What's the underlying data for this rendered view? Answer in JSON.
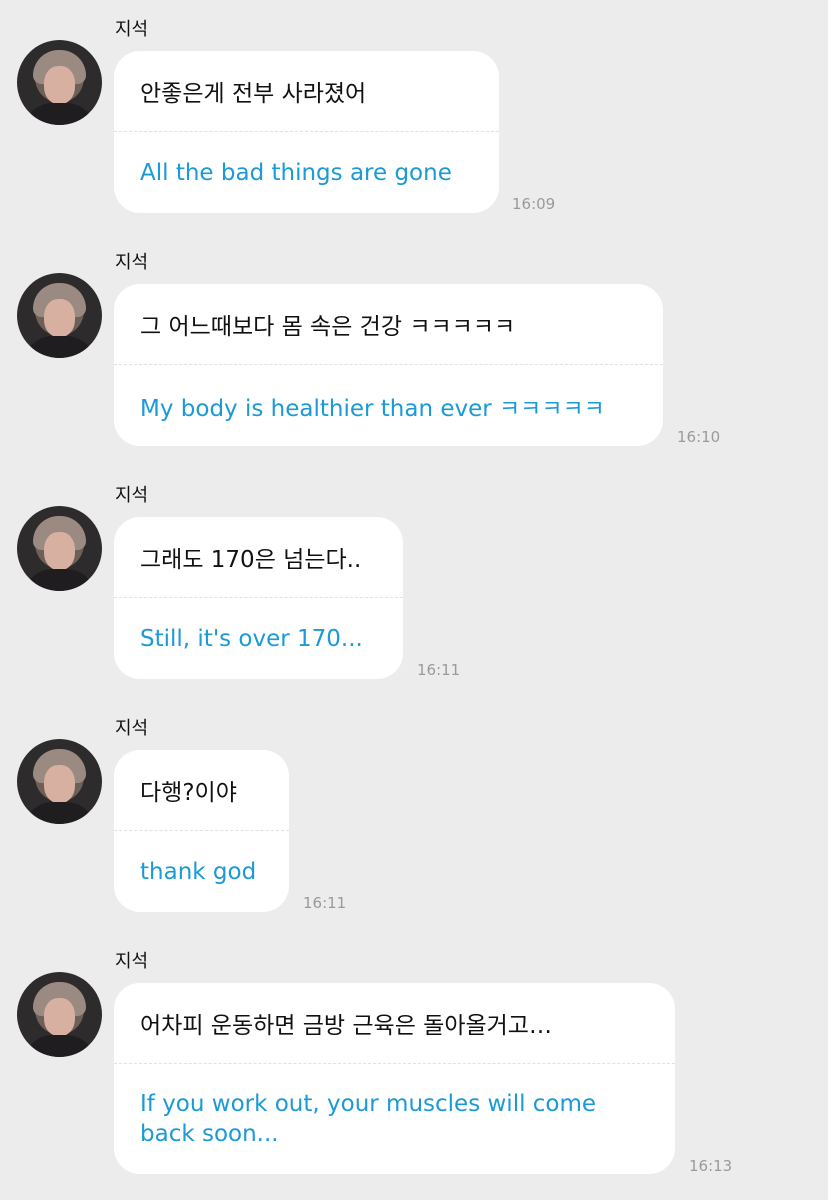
{
  "messages": [
    {
      "sender": "지석",
      "korean": "안좋은게 전부 사라졌어",
      "english": "All the bad things are gone",
      "time": "16:09"
    },
    {
      "sender": "지석",
      "korean": "그 어느때보다 몸 속은 건강 ㅋㅋㅋㅋㅋ",
      "english": "My body is healthier than ever ㅋㅋㅋㅋㅋ",
      "time": "16:10"
    },
    {
      "sender": "지석",
      "korean": "그래도 170은 넘는다..",
      "english": "Still, it's over 170...",
      "time": "16:11"
    },
    {
      "sender": "지석",
      "korean": "다행?이야",
      "english": "thank god",
      "time": "16:11"
    },
    {
      "sender": "지석",
      "korean": "어차피 운동하면 금방 근육은 돌아올거고…",
      "english": "If you work out, your muscles will come back soon...",
      "time": "16:13"
    }
  ]
}
